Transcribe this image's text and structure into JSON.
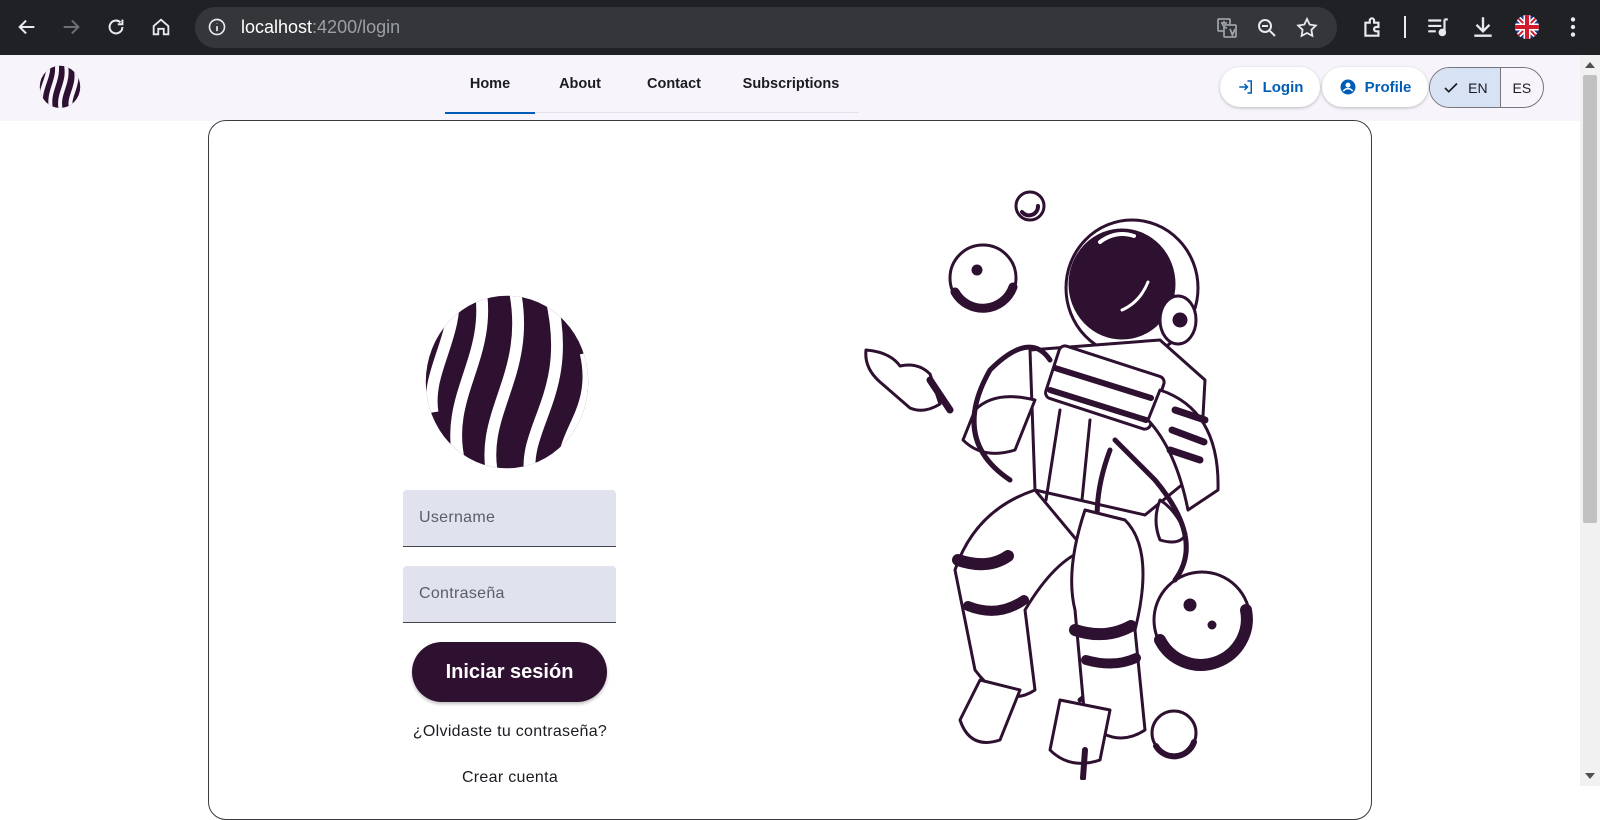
{
  "browser": {
    "url_host": "localhost",
    "url_path": ":4200/login"
  },
  "header": {
    "tabs": [
      {
        "label": "Home",
        "active": true
      },
      {
        "label": "About",
        "active": false
      },
      {
        "label": "Contact",
        "active": false
      },
      {
        "label": "Subscriptions",
        "active": false
      }
    ],
    "login_label": "Login",
    "profile_label": "Profile",
    "lang": {
      "en": "EN",
      "es": "ES",
      "selected": "EN"
    }
  },
  "form": {
    "username_placeholder": "Username",
    "password_placeholder": "Contraseña",
    "submit_label": "Iniciar sesión",
    "forgot_label": "¿Olvidaste tu contraseña?",
    "create_label": "Crear cuenta"
  },
  "colors": {
    "brand": "#2e1030",
    "accent": "#005db6",
    "header_bg": "#f7f5fb",
    "field_bg": "#e0e2ee"
  },
  "icons": {
    "back": "arrow-left-icon",
    "forward": "arrow-right-icon",
    "reload": "reload-icon",
    "home": "home-icon",
    "translate": "translate-icon",
    "zoom": "zoom-out-icon",
    "bookmark": "star-icon",
    "extensions": "puzzle-icon",
    "media": "media-queue-icon",
    "download": "download-icon",
    "profile_flag": "uk-flag-icon",
    "menu": "kebab-menu-icon"
  }
}
